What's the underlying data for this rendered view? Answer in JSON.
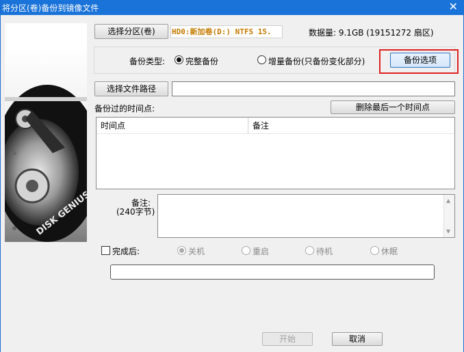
{
  "window": {
    "title": "将分区(卷)备份到镜像文件",
    "close_glyph": "✕"
  },
  "partition": {
    "select_button": "选择分区(卷)",
    "info": "HD0:新加卷(D:) NTFS 15.",
    "data_amount": "数据量: 9.1GB (19151272 扇区)"
  },
  "backup_type": {
    "label": "备份类型:",
    "options": [
      {
        "label": "完整备份",
        "selected": true
      },
      {
        "label": "增量备份(只备份变化部分)",
        "selected": false
      }
    ],
    "options_button": "备份选项"
  },
  "file_path": {
    "button": "选择文件路径",
    "value": ""
  },
  "timepoints": {
    "label": "备份过的时间点:",
    "delete_button": "删除最后一个时间点",
    "columns": [
      "时间点",
      "备注"
    ]
  },
  "note": {
    "label": "备注:",
    "sublabel": "(240字节)",
    "value": ""
  },
  "after_completion": {
    "label": "完成后:",
    "options": [
      {
        "label": "关机",
        "selected": true
      },
      {
        "label": "重启",
        "selected": false
      },
      {
        "label": "待机",
        "selected": false
      },
      {
        "label": "休眠",
        "selected": false
      }
    ]
  },
  "progress": {
    "value": 0
  },
  "footer": {
    "start_button": "开始",
    "cancel_button": "取消"
  },
  "side_image": {
    "icon": "hard-disk",
    "text": "DISK GENIUS"
  }
}
